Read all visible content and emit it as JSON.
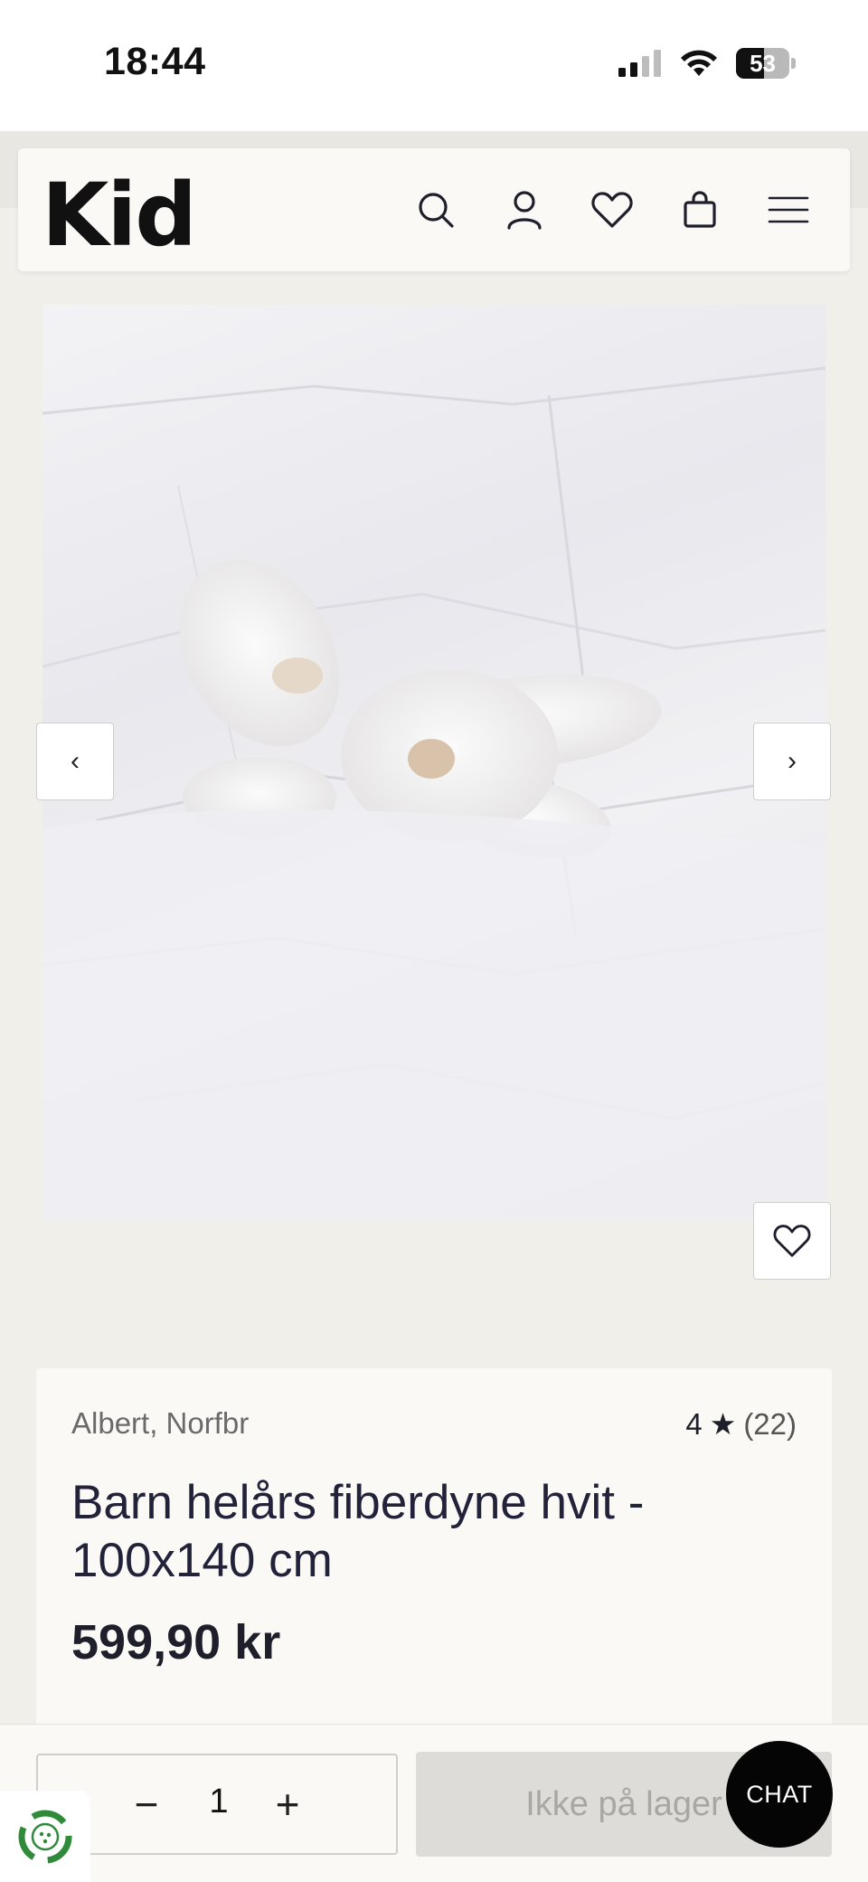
{
  "status_bar": {
    "time": "18:44",
    "battery": "53"
  },
  "header": {
    "logo": "Kid",
    "icons": [
      "search-icon",
      "account-icon",
      "wishlist-icon",
      "cart-icon",
      "menu-icon"
    ]
  },
  "gallery": {
    "prev_label": "‹",
    "next_label": "›"
  },
  "product": {
    "brand": "Albert, Norfbr",
    "rating": "4",
    "rating_star": "★",
    "review_count": "(22)",
    "title": "Barn helårs fiberdyne hvit - 100x140 cm",
    "price": "599,90 kr"
  },
  "purchase_bar": {
    "minus": "−",
    "quantity": "1",
    "plus": "+",
    "stock_button": "Ikke på lager"
  },
  "chat_button": "CHAT",
  "colors": {
    "background": "#f1efea",
    "card": "#faf9f5",
    "text": "#1f1f2c",
    "disabled": "#dedcd8"
  }
}
